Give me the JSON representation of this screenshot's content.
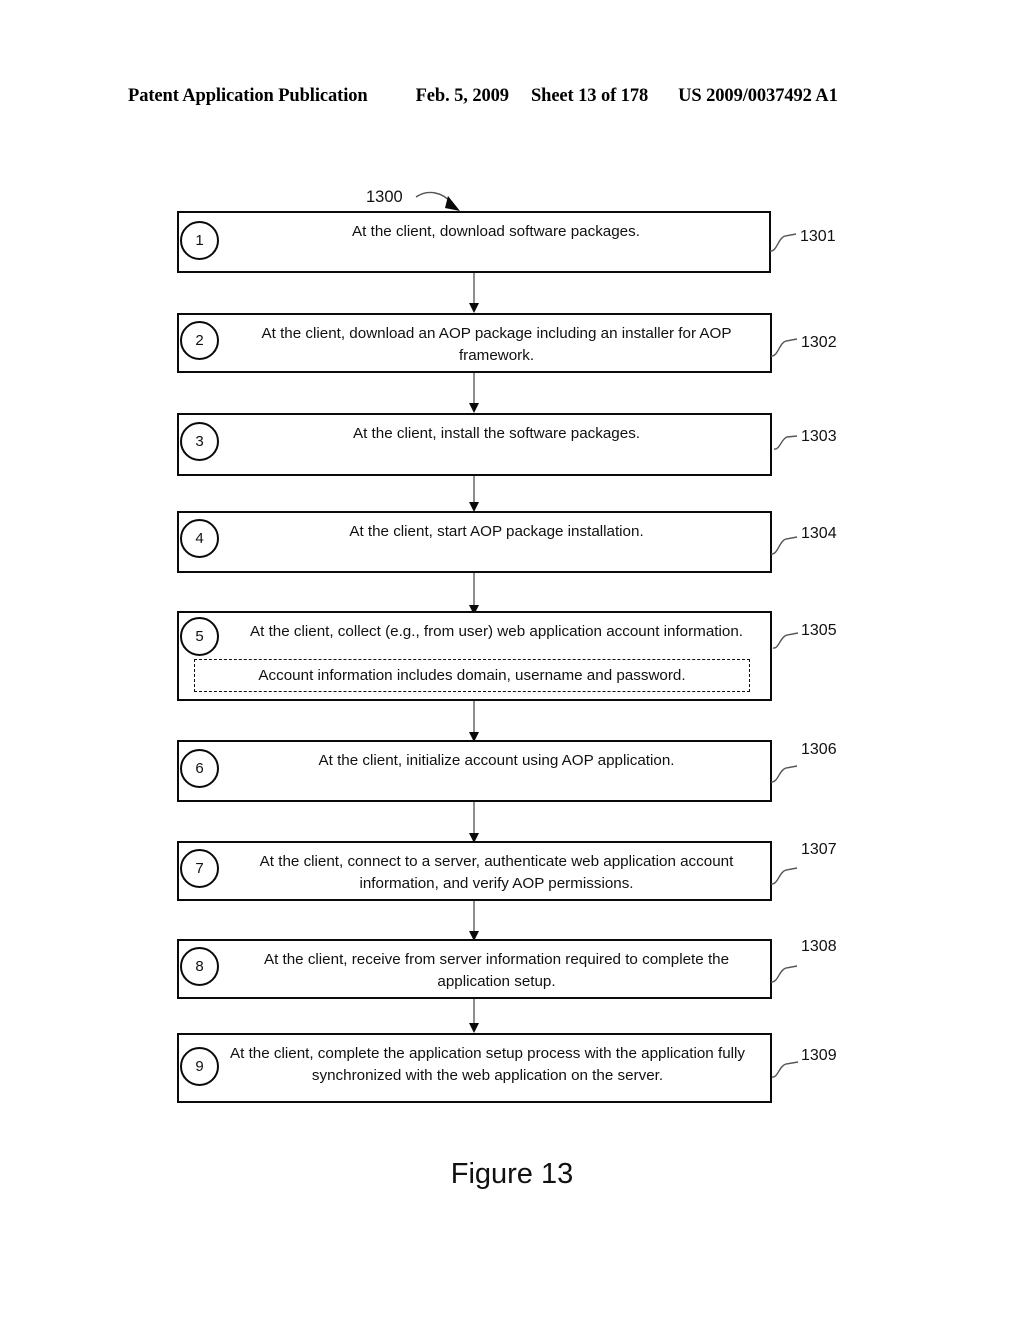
{
  "header": {
    "title": "Patent Application Publication",
    "date": "Feb. 5, 2009",
    "sheet": "Sheet 13 of 178",
    "patent_number": "US 2009/0037492 A1"
  },
  "figure": {
    "caption": "Figure 13",
    "diagram_ref": "1300"
  },
  "steps": [
    {
      "number": "1",
      "text": "At the client, download software packages.",
      "ref": "1301"
    },
    {
      "number": "2",
      "text": "At the client, download an AOP package including an installer for AOP framework.",
      "ref": "1302"
    },
    {
      "number": "3",
      "text": "At the client, install the software packages.",
      "ref": "1303"
    },
    {
      "number": "4",
      "text": "At the client, start AOP package installation.",
      "ref": "1304"
    },
    {
      "number": "5",
      "text": "At the client, collect (e.g., from user) web application account information.",
      "ref": "1305",
      "note": "Account information includes domain, username and password."
    },
    {
      "number": "6",
      "text": "At the client, initialize account using AOP application.",
      "ref": "1306"
    },
    {
      "number": "7",
      "text": "At the client, connect to a server, authenticate web application account information, and verify AOP permissions.",
      "ref": "1307"
    },
    {
      "number": "8",
      "text": "At the client, receive from server information required to complete the application setup.",
      "ref": "1308"
    },
    {
      "number": "9",
      "text": "At the client, complete the application setup process with the application fully synchronized with the web application on the server.",
      "ref": "1309"
    }
  ],
  "colors": {
    "ink": "#0a0a0a",
    "connector": "#8e8e8e",
    "paper": "#ffffff"
  }
}
